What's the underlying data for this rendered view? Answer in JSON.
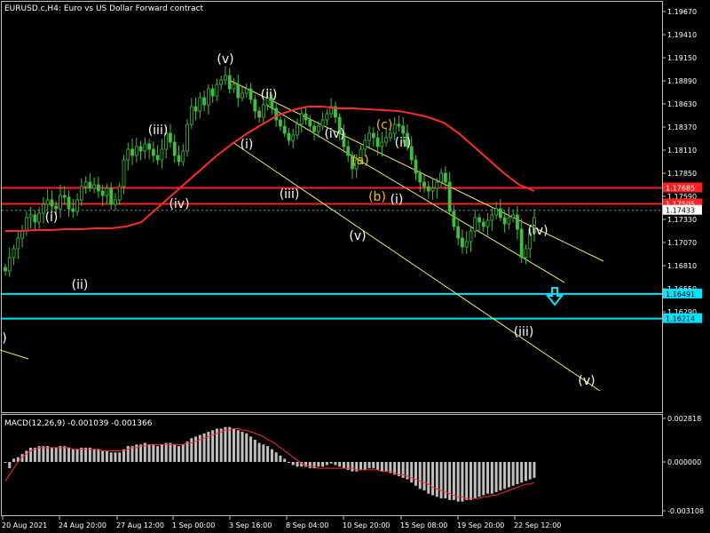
{
  "window": {
    "title": "EURUSD.c,H4:  Euro vs US Dollar Forward contract",
    "macd_title": "MACD(12,26,9) -0.001039 -0.001366"
  },
  "colors": {
    "background": "#000000",
    "candles": "#3fbf3f",
    "ma_line": "#ff2a2a",
    "channel_lines": "#f0f060",
    "support_lines": "#00e5ff",
    "resistance_lines": "#ff1f1f",
    "wave_labels": "#ffffff",
    "wave_labels_abc": "#e6c200",
    "macd_bars": "#c0c0c0",
    "macd_signal": "#ff2a2a",
    "arrow": "#00e5ff"
  },
  "price_axis": {
    "ticks": [
      "1.19670",
      "1.19410",
      "1.19150",
      "1.18890",
      "1.18630",
      "1.18370",
      "1.18110",
      "1.17850",
      "1.17590",
      "1.17330",
      "1.17070",
      "1.16810",
      "1.16550",
      "1.16290"
    ],
    "badges": [
      {
        "label": "1.17685",
        "color": "#ff1f1f"
      },
      {
        "label": "1.17505",
        "color": "#ff1f1f"
      },
      {
        "label": "1.17433",
        "color": "#ffffff"
      },
      {
        "label": "1.16491",
        "color": "#00e5ff"
      },
      {
        "label": "1.16214",
        "color": "#00e5ff"
      }
    ]
  },
  "macd_axis": {
    "ticks": [
      "0.002818",
      "0.000000",
      "-0.003108"
    ]
  },
  "time_axis": {
    "labels": [
      "20 Aug 2021",
      "24 Aug 20:00",
      "27 Aug 12:00",
      "1 Sep 00:00",
      "3 Sep 16:00",
      "8 Sep 04:00",
      "10 Sep 20:00",
      "15 Sep 08:00",
      "19 Sep 20:00",
      "22 Sep 12:00"
    ]
  },
  "wave_labels": [
    {
      "text": "(i)"
    },
    {
      "text": "(ii)"
    },
    {
      "text": "(iii)"
    },
    {
      "text": "(iv)"
    },
    {
      "text": "(v)"
    },
    {
      "text": "(ii)"
    },
    {
      "text": "(i)"
    },
    {
      "text": "(iii)"
    },
    {
      "text": "(iv)"
    },
    {
      "text": "(v)"
    },
    {
      "text": "(c)"
    },
    {
      "text": "(a)"
    },
    {
      "text": "(b)"
    },
    {
      "text": "(ii)"
    },
    {
      "text": "(i)"
    },
    {
      "text": "(iv)"
    },
    {
      "text": "(iii)"
    },
    {
      "text": "(v)"
    },
    {
      "text": ")"
    }
  ],
  "chart_data": {
    "type": "candlestick",
    "symbol": "EURUSD.c",
    "timeframe": "H4",
    "ylim": [
      1.1615,
      1.198
    ],
    "horizontal_levels": [
      1.17685,
      1.17505,
      1.16491,
      1.16214
    ],
    "current_price": 1.17433,
    "close": [
      1.1675,
      1.169,
      1.17,
      1.1712,
      1.172,
      1.1735,
      1.1738,
      1.173,
      1.174,
      1.175,
      1.1755,
      1.1748,
      1.1745,
      1.176,
      1.1758,
      1.1745,
      1.1742,
      1.1755,
      1.177,
      1.1775,
      1.1768,
      1.1772,
      1.1765,
      1.176,
      1.1768,
      1.175,
      1.1755,
      1.177,
      1.18,
      1.1812,
      1.1805,
      1.1815,
      1.181,
      1.1818,
      1.1812,
      1.1805,
      1.18,
      1.1812,
      1.183,
      1.182,
      1.1805,
      1.1798,
      1.181,
      1.184,
      1.186,
      1.1855,
      1.187,
      1.1862,
      1.188,
      1.1872,
      1.1885,
      1.189,
      1.1895,
      1.188,
      1.1885,
      1.187,
      1.1875,
      1.188,
      1.1868,
      1.1855,
      1.1848,
      1.1862,
      1.187,
      1.1858,
      1.1845,
      1.1838,
      1.183,
      1.1822,
      1.1828,
      1.184,
      1.1852,
      1.1845,
      1.1838,
      1.1832,
      1.1838,
      1.1845,
      1.1852,
      1.186,
      1.1848,
      1.183,
      1.1815,
      1.1805,
      1.179,
      1.18,
      1.1812,
      1.1822,
      1.183,
      1.1825,
      1.1815,
      1.182,
      1.1825,
      1.183,
      1.184,
      1.1838,
      1.183,
      1.1815,
      1.18,
      1.1785,
      1.1775,
      1.177,
      1.1765,
      1.1768,
      1.1775,
      1.1785,
      1.1775,
      1.1742,
      1.1725,
      1.1712,
      1.1702,
      1.1708,
      1.172,
      1.1735,
      1.173,
      1.1725,
      1.1732,
      1.1738,
      1.1745,
      1.1735,
      1.1728,
      1.1735,
      1.1738,
      1.1722,
      1.169,
      1.17,
      1.1718,
      1.1735
    ],
    "ma_line": [
      1.172,
      1.172,
      1.1721,
      1.1721,
      1.1722,
      1.1722,
      1.1723,
      1.1723,
      1.1725,
      1.173,
      1.1745,
      1.176,
      1.1775,
      1.179,
      1.1805,
      1.1818,
      1.183,
      1.184,
      1.185,
      1.1856,
      1.186,
      1.186,
      1.1858,
      1.1858,
      1.1857,
      1.1856,
      1.1855,
      1.1852,
      1.1848,
      1.1842,
      1.183,
      1.1815,
      1.18,
      1.1785,
      1.1772,
      1.1765
    ],
    "macd_histogram": [
      0.0,
      -0.0004,
      0.0002,
      0.0003,
      0.0005,
      0.0007,
      0.0009,
      0.0009,
      0.001,
      0.001,
      0.001,
      0.0009,
      0.0009,
      0.001,
      0.001,
      0.0009,
      0.0008,
      0.0008,
      0.0009,
      0.0009,
      0.0009,
      0.0008,
      0.0008,
      0.0007,
      0.0007,
      0.0006,
      0.0006,
      0.0006,
      0.0008,
      0.001,
      0.001,
      0.0011,
      0.0011,
      0.0012,
      0.0011,
      0.0011,
      0.001,
      0.0011,
      0.0012,
      0.0012,
      0.0011,
      0.001,
      0.0011,
      0.0013,
      0.0015,
      0.0016,
      0.0017,
      0.0018,
      0.0019,
      0.002,
      0.0021,
      0.0021,
      0.0022,
      0.0022,
      0.0021,
      0.002,
      0.0019,
      0.0018,
      0.0016,
      0.0014,
      0.0012,
      0.0011,
      0.001,
      0.0008,
      0.0006,
      0.0004,
      0.0002,
      0.0,
      -0.0002,
      -0.0003,
      -0.0003,
      -0.0003,
      -0.0004,
      -0.0004,
      -0.0003,
      -0.0003,
      -0.0002,
      -0.0001,
      -0.0002,
      -0.0003,
      -0.0004,
      -0.0005,
      -0.0006,
      -0.0006,
      -0.0005,
      -0.0005,
      -0.0004,
      -0.0004,
      -0.0005,
      -0.0006,
      -0.0006,
      -0.0007,
      -0.0008,
      -0.0009,
      -0.001,
      -0.0011,
      -0.0013,
      -0.0015,
      -0.0017,
      -0.0018,
      -0.002,
      -0.0021,
      -0.0022,
      -0.0023,
      -0.0023,
      -0.0024,
      -0.0024,
      -0.0025,
      -0.0025,
      -0.0024,
      -0.0024,
      -0.0023,
      -0.0022,
      -0.0021,
      -0.002,
      -0.002,
      -0.0019,
      -0.0018,
      -0.0017,
      -0.0016,
      -0.0015,
      -0.0014,
      -0.0013,
      -0.0012,
      -0.0011,
      -0.001
    ],
    "macd_signal": [
      -0.0012,
      -0.0008,
      -0.0004,
      0.0,
      0.0003,
      0.0005,
      0.0007,
      0.0008,
      0.0009,
      0.0009,
      0.0009,
      0.0009,
      0.0009,
      0.0009,
      0.0009,
      0.0009,
      0.0008,
      0.0008,
      0.0008,
      0.0008,
      0.0008,
      0.0008,
      0.0008,
      0.0007,
      0.0007,
      0.0007,
      0.0007,
      0.0007,
      0.0007,
      0.0008,
      0.0009,
      0.0009,
      0.001,
      0.001,
      0.0011,
      0.0011,
      0.0011,
      0.0011,
      0.0011,
      0.0011,
      0.0011,
      0.0011,
      0.0011,
      0.0012,
      0.0012,
      0.0013,
      0.0014,
      0.0015,
      0.0016,
      0.0017,
      0.0018,
      0.0019,
      0.002,
      0.002,
      0.0021,
      0.0021,
      0.002,
      0.002,
      0.0019,
      0.0018,
      0.0017,
      0.0016,
      0.0014,
      0.0013,
      0.0011,
      0.0009,
      0.0007,
      0.0005,
      0.0003,
      0.0001,
      -0.0001,
      -0.0002,
      -0.0003,
      -0.0003,
      -0.0004,
      -0.0004,
      -0.0004,
      -0.0004,
      -0.0004,
      -0.0004,
      -0.0004,
      -0.0004,
      -0.0004,
      -0.0005,
      -0.0005,
      -0.0005,
      -0.0005,
      -0.0005,
      -0.0005,
      -0.0006,
      -0.0006,
      -0.0006,
      -0.0007,
      -0.0008,
      -0.0008,
      -0.0009,
      -0.001,
      -0.0011,
      -0.0012,
      -0.0013,
      -0.0014,
      -0.0016,
      -0.0017,
      -0.0018,
      -0.0019,
      -0.002,
      -0.0021,
      -0.0022,
      -0.0022,
      -0.0023,
      -0.0023,
      -0.0023,
      -0.0023,
      -0.0022,
      -0.0022,
      -0.0021,
      -0.0021,
      -0.002,
      -0.0019,
      -0.0018,
      -0.0017,
      -0.0016,
      -0.0015,
      -0.0014,
      -0.0014,
      -0.0013
    ],
    "macd_ylim": [
      -0.003108,
      0.002818
    ]
  }
}
